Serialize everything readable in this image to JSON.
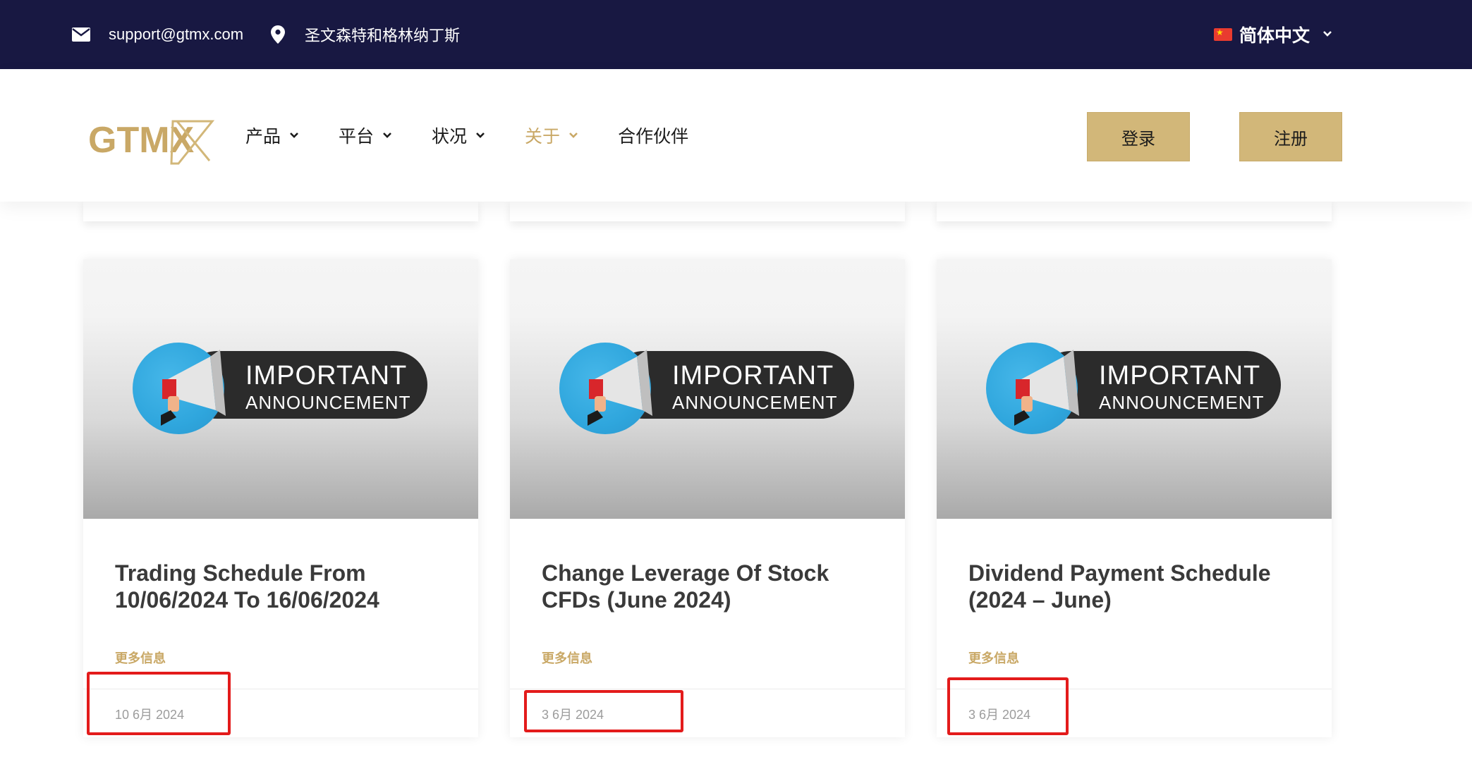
{
  "topbar": {
    "email": "support@gtmx.com",
    "location": "圣文森特和格林纳丁斯",
    "language": "简体中文"
  },
  "header": {
    "logo": "GTMX",
    "nav": [
      {
        "label": "产品",
        "has_dropdown": true
      },
      {
        "label": "平台",
        "has_dropdown": true
      },
      {
        "label": "状况",
        "has_dropdown": true
      },
      {
        "label": "关于",
        "has_dropdown": true,
        "active": true
      },
      {
        "label": "合作伙伴",
        "has_dropdown": false
      }
    ],
    "login_label": "登录",
    "signup_label": "注册"
  },
  "cards": [
    {
      "image_line1": "IMPORTANT",
      "image_line2": "ANNOUNCEMENT",
      "title": "Trading Schedule From 10/06/2024 To 16/06/2024",
      "more": "更多信息",
      "date": "10 6月 2024"
    },
    {
      "image_line1": "IMPORTANT",
      "image_line2": "ANNOUNCEMENT",
      "title": "Change Leverage Of Stock CFDs (June 2024)",
      "more": "更多信息",
      "date": "3 6月 2024"
    },
    {
      "image_line1": "IMPORTANT",
      "image_line2": "ANNOUNCEMENT",
      "title": "Dividend Payment Schedule (2024 – June)",
      "more": "更多信息",
      "date": "3 6月 2024"
    }
  ],
  "colors": {
    "topbar_bg": "#181842",
    "accent_gold": "#c9a866",
    "button_gold": "#d2b779",
    "highlight_red": "#e31b1b"
  },
  "icons": {
    "email": "envelope-icon",
    "location": "map-pin-icon",
    "dropdown": "chevron-down-icon",
    "flag": "china-flag-icon"
  }
}
